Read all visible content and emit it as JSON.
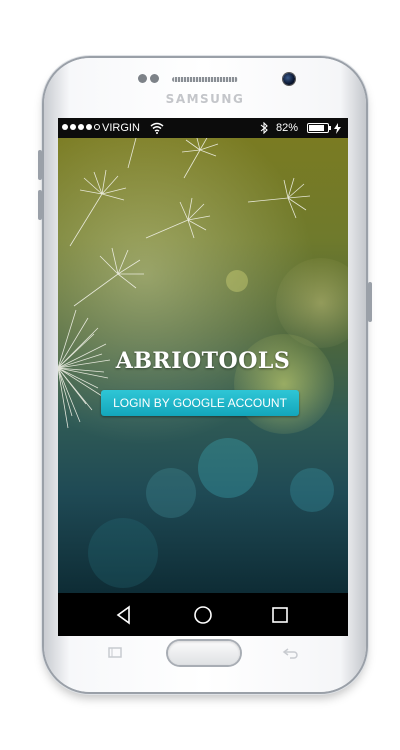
{
  "device": {
    "brand": "SAMSUNG"
  },
  "status_bar": {
    "carrier": "VIRGIN",
    "battery_percent": "82%",
    "battery_level": 0.82,
    "signal_bars_filled": 4,
    "signal_bars_total": 5
  },
  "app": {
    "title": "ABRIOTOOLS",
    "login_button_label": "LOGIN BY GOOGLE ACCOUNT",
    "accent_color": "#1eb5c8"
  },
  "nav_bar": {
    "back_icon": "back-triangle-icon",
    "home_icon": "home-circle-icon",
    "recents_icon": "recents-square-icon"
  }
}
